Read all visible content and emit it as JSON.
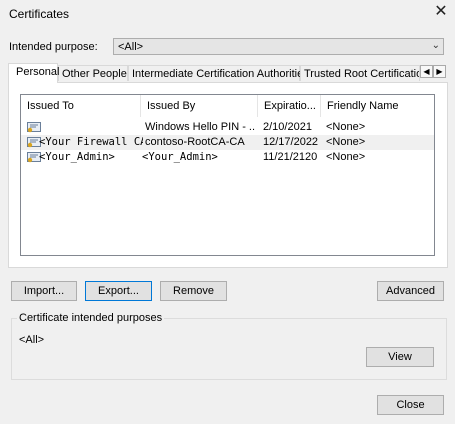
{
  "window": {
    "title": "Certificates"
  },
  "purpose": {
    "label": "Intended purpose:",
    "value": "<All>"
  },
  "tabs": [
    {
      "label": "Personal"
    },
    {
      "label": "Other People"
    },
    {
      "label": "Intermediate Certification Authorities"
    },
    {
      "label": "Trusted Root Certification"
    }
  ],
  "columns": [
    "Issued To",
    "Issued By",
    "Expiratio...",
    "Friendly Name"
  ],
  "rows": [
    {
      "issued_to": "",
      "issued_by": "Windows Hello PIN - ...",
      "expiration": "2/10/2021",
      "friendly_name": "<None>"
    },
    {
      "issued_to": "<Your Firewall CA>",
      "issued_by": "contoso-RootCA-CA",
      "expiration": "12/17/2022",
      "friendly_name": "<None>"
    },
    {
      "issued_to": "<Your_Admin>",
      "issued_by": "<Your_Admin>",
      "expiration": "11/21/2120",
      "friendly_name": "<None>"
    }
  ],
  "buttons": {
    "import": "Import...",
    "export": "Export...",
    "remove": "Remove",
    "advanced": "Advanced",
    "view": "View",
    "close": "Close"
  },
  "purposes_group": {
    "title": "Certificate intended purposes",
    "value": "<All>"
  },
  "icons": {
    "close": "close-icon",
    "dropdown": "chevron-down-icon",
    "certificate": "certificate-icon"
  },
  "colors": {
    "focus_border": "#0078d7",
    "selected_row": "#f0f0f0"
  }
}
